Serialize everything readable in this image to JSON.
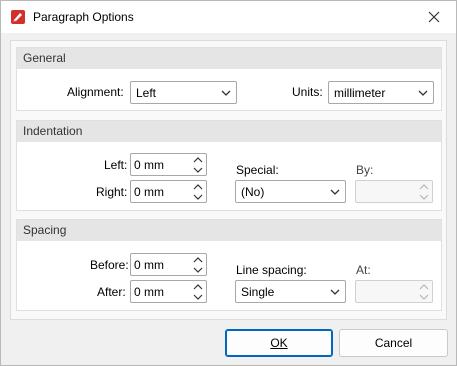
{
  "window": {
    "title": "Paragraph Options"
  },
  "general": {
    "header": "General",
    "alignment_label": "Alignment:",
    "alignment_value": "Left",
    "units_label": "Units:",
    "units_value": "millimeter"
  },
  "indentation": {
    "header": "Indentation",
    "left_label": "Left:",
    "left_value": "0 mm",
    "right_label": "Right:",
    "right_value": "0 mm",
    "special_label": "Special:",
    "special_value": "(No)",
    "by_label": "By:",
    "by_value": ""
  },
  "spacing": {
    "header": "Spacing",
    "before_label": "Before:",
    "before_value": "0 mm",
    "after_label": "After:",
    "after_value": "0 mm",
    "line_spacing_label": "Line spacing:",
    "line_spacing_value": "Single",
    "at_label": "At:",
    "at_value": ""
  },
  "buttons": {
    "ok": "OK",
    "cancel": "Cancel"
  },
  "colors": {
    "accent": "#0067c0",
    "icon_red": "#d4302b",
    "header_bg": "#e5e5e5"
  }
}
